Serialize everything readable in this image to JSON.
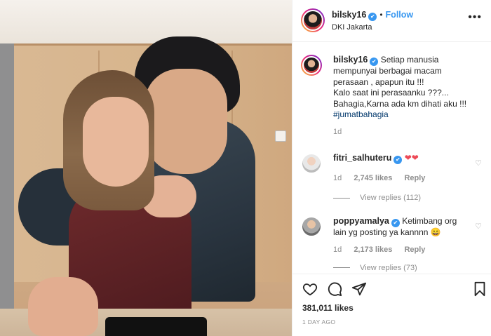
{
  "post": {
    "username": "bilsky16",
    "verified_mark": "✔",
    "separator": "•",
    "follow_label": "Follow",
    "location": "DKI Jakarta",
    "more_icon": "•••"
  },
  "caption": {
    "username": "bilsky16",
    "text_lines": [
      "Setiap manusia",
      "mempunyai berbagai macam",
      "perasaan , apapun itu !!!",
      "Kalo saat ini perasaanku ???...",
      "Bahagia,Karna ada km dihati aku !!!"
    ],
    "hashtag": "#jumatbahagia",
    "time": "1d"
  },
  "comments": [
    {
      "username": "fitri_salhuteru",
      "text": "",
      "emoji": "❤❤",
      "time": "1d",
      "likes": "2,745 likes",
      "reply_label": "Reply",
      "view_replies": "View replies (112)"
    },
    {
      "username": "poppyamalya",
      "text_line1": "Ketimbang org",
      "text_line2": "lain yg posting ya kannnn",
      "emoji": "😄",
      "time": "1d",
      "likes": "2,173 likes",
      "reply_label": "Reply",
      "view_replies": "View replies (73)"
    }
  ],
  "actions": {
    "like_icon": "heart-outline-icon",
    "comment_icon": "comment-bubble-icon",
    "share_icon": "paper-plane-icon",
    "save_icon": "bookmark-icon"
  },
  "likes_count": "381,011 likes",
  "date": "1 DAY AGO",
  "colors": {
    "accent": "#3897f0",
    "text": "#262626",
    "muted": "#8e8e8e",
    "hashtag": "#00376b",
    "heart": "#ed4956"
  }
}
